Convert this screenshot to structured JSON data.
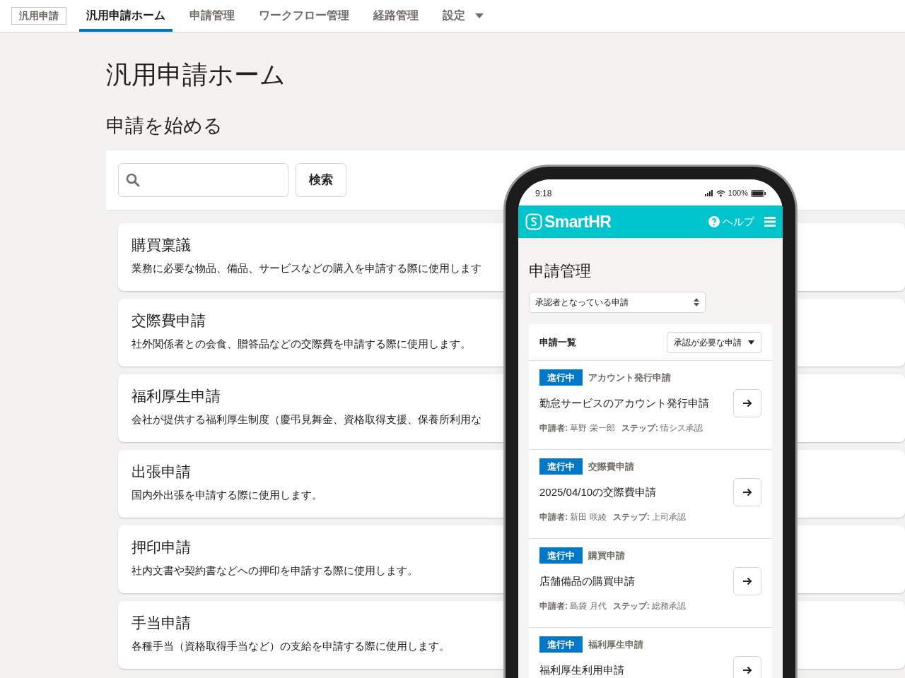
{
  "nav": {
    "app_label": "汎用申請",
    "tabs": [
      {
        "label": "汎用申請ホーム",
        "selected": true,
        "dropdown": false
      },
      {
        "label": "申請管理",
        "selected": false,
        "dropdown": false
      },
      {
        "label": "ワークフロー管理",
        "selected": false,
        "dropdown": false
      },
      {
        "label": "経路管理",
        "selected": false,
        "dropdown": false
      },
      {
        "label": "設定",
        "selected": false,
        "dropdown": true
      }
    ]
  },
  "page_title": "汎用申請ホーム",
  "section_title": "申請を始める",
  "search": {
    "button": "検索"
  },
  "request_types": [
    {
      "title": "購買稟議",
      "description": "業務に必要な物品、備品、サービスなどの購入を申請する際に使用します"
    },
    {
      "title": "交際費申請",
      "description": "社外関係者との会食、贈答品などの交際費を申請する際に使用します。"
    },
    {
      "title": "福利厚生申請",
      "description": "会社が提供する福利厚生制度（慶弔見舞金、資格取得支援、保養所利用な"
    },
    {
      "title": "出張申請",
      "description": "国内外出張を申請する際に使用します。"
    },
    {
      "title": "押印申請",
      "description": "社内文書や契約書などへの押印を申請する際に使用します。"
    },
    {
      "title": "手当申請",
      "description": "各種手当（資格取得手当など）の支給を申請する際に使用します。"
    }
  ],
  "phone": {
    "time": "9:18",
    "battery": "100%",
    "brand": "SmartHR",
    "help": "ヘルプ",
    "title": "申請管理",
    "filter": "承認者となっている申請",
    "list_title": "申請一覧",
    "list_filter": "承認が必要な申請",
    "items": [
      {
        "status": "進行中",
        "type": "アカウント発行申請",
        "name": "勤怠サービスのアカウント発行申請",
        "applicant_label": "申請者:",
        "applicant": "草野 栄一郎",
        "step_label": "ステップ:",
        "step": "情シス承認"
      },
      {
        "status": "進行中",
        "type": "交際費申請",
        "name": "2025/04/10の交際費申請",
        "applicant_label": "申請者:",
        "applicant": "新田 咲綾",
        "step_label": "ステップ:",
        "step": "上司承認"
      },
      {
        "status": "進行中",
        "type": "購買申請",
        "name": "店舗備品の購買申請",
        "applicant_label": "申請者:",
        "applicant": "島袋 月代",
        "step_label": "ステップ:",
        "step": "総務承認"
      },
      {
        "status": "進行中",
        "type": "福利厚生申請",
        "name": "福利厚生利用申請"
      }
    ]
  }
}
